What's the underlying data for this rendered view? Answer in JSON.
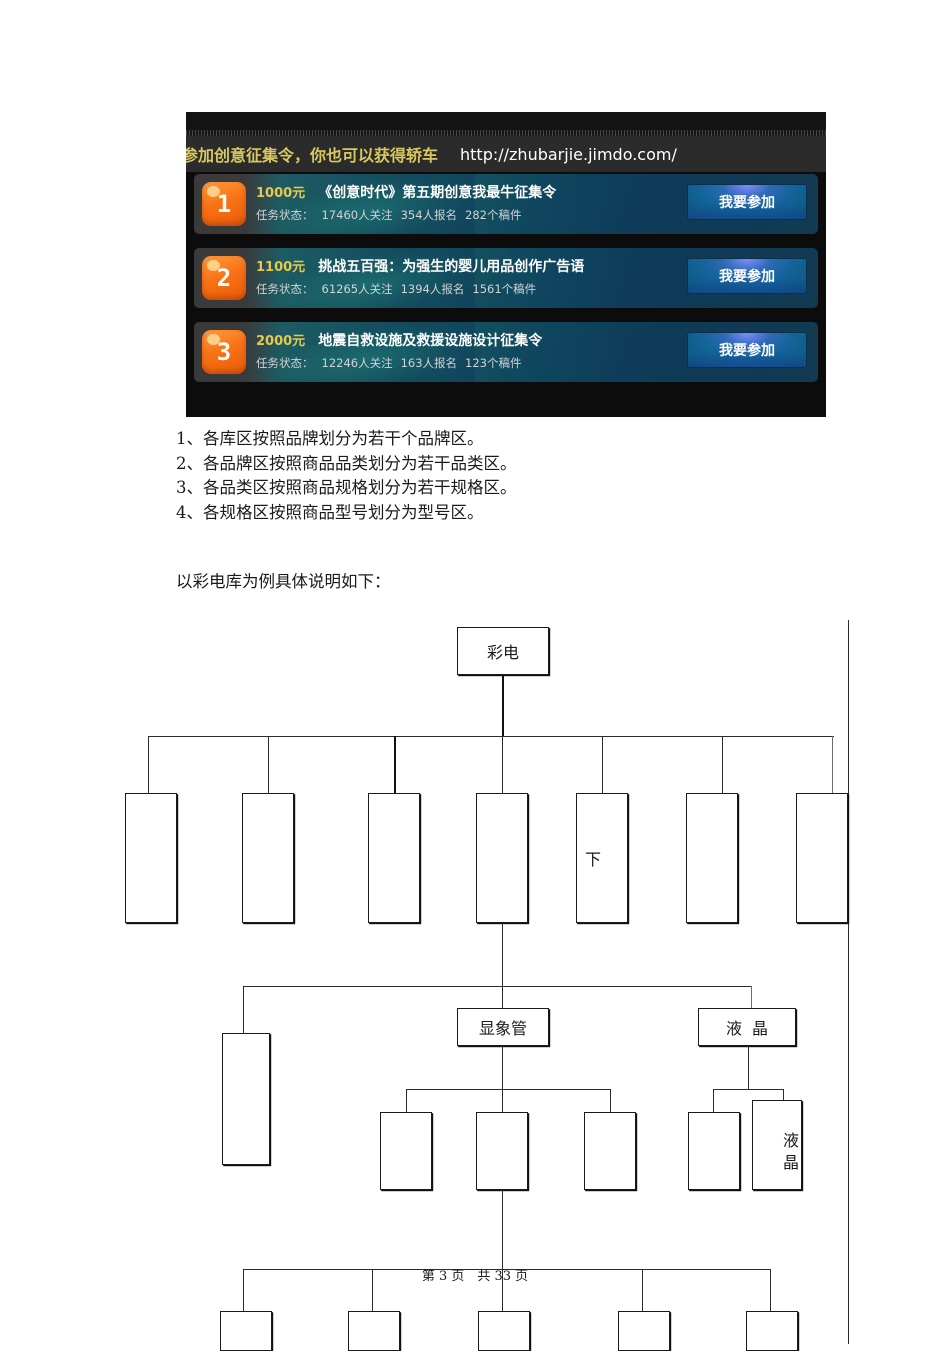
{
  "ad": {
    "headline": "参加创意征集令，你也可以获得轿车",
    "url": "http://zhubarjie.jimdo.com/",
    "join_label": "我要参加",
    "rows": [
      {
        "badge": "1",
        "price": "1000元",
        "title": "《创意时代》第五期创意我最牛征集令",
        "status_label": "任务状态：",
        "followers": "17460人关注",
        "signups": "354人报名",
        "submissions": "282个稿件"
      },
      {
        "badge": "2",
        "price": "1100元",
        "title": "挑战五百强：为强生的婴儿用品创作广告语",
        "status_label": "任务状态：",
        "followers": "61265人关注",
        "signups": "1394人报名",
        "submissions": "1561个稿件"
      },
      {
        "badge": "3",
        "price": "2000元",
        "title": "地震自救设施及救援设施设计征集令",
        "status_label": "任务状态：",
        "followers": "12246人关注",
        "signups": "163人报名",
        "submissions": "123个稿件"
      }
    ],
    "colors": {
      "headline_text": "#d8c860",
      "badge": "#f97316",
      "button": "#13649a",
      "panel": "#0d3f5e"
    }
  },
  "document": {
    "list_items": [
      "1、各库区按照品牌划分为若干个品牌区。",
      "2、各品牌区按照商品品类划分为若干品类区。",
      "3、各品类区按照商品规格划分为若干规格区。",
      "4、各规格区按照商品型号划分为型号区。"
    ],
    "paragraph": "以彩电库为例具体说明如下：",
    "footer": "第 3 页　共 33 页"
  },
  "diagram": {
    "root": "彩电",
    "level1": [
      "",
      "",
      "",
      "",
      "下",
      "",
      ""
    ],
    "level2": {
      "left_box": "",
      "crt": "显象管",
      "lcd": "液晶"
    },
    "level3": {
      "crt_children": [
        "",
        "",
        ""
      ],
      "lcd_children": [
        "",
        "液晶"
      ]
    },
    "level4": [
      "",
      "",
      "",
      "",
      ""
    ]
  }
}
